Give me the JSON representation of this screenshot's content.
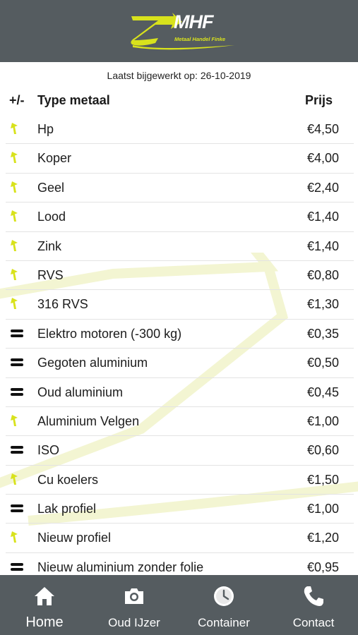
{
  "header": {
    "logo_letters": "MHF",
    "logo_subtitle": "Metaal Handel Finke",
    "background": "#555c60",
    "accent": "#d8e21c"
  },
  "updated_text": "Laatst bijgewerkt op: 26-10-2019",
  "table": {
    "headers": {
      "change": "+/-",
      "type": "Type metaal",
      "price": "Prijs"
    },
    "rows": [
      {
        "trend": "up",
        "name": "Hp",
        "price": "€4,50"
      },
      {
        "trend": "up",
        "name": "Koper",
        "price": "€4,00"
      },
      {
        "trend": "up",
        "name": "Geel",
        "price": "€2,40"
      },
      {
        "trend": "up",
        "name": "Lood",
        "price": "€1,40"
      },
      {
        "trend": "up",
        "name": "Zink",
        "price": "€1,40"
      },
      {
        "trend": "up",
        "name": "RVS",
        "price": "€0,80"
      },
      {
        "trend": "up",
        "name": "316 RVS",
        "price": "€1,30"
      },
      {
        "trend": "equal",
        "name": "Elektro motoren (-300 kg)",
        "price": "€0,35"
      },
      {
        "trend": "equal",
        "name": "Gegoten aluminium",
        "price": "€0,50"
      },
      {
        "trend": "equal",
        "name": "Oud aluminium",
        "price": "€0,45"
      },
      {
        "trend": "up",
        "name": "Aluminium Velgen",
        "price": "€1,00"
      },
      {
        "trend": "equal",
        "name": "ISO",
        "price": "€0,60"
      },
      {
        "trend": "up",
        "name": "Cu koelers",
        "price": "€1,50"
      },
      {
        "trend": "equal",
        "name": "Lak profiel",
        "price": "€1,00"
      },
      {
        "trend": "up",
        "name": "Nieuw profiel",
        "price": "€1,20"
      },
      {
        "trend": "equal",
        "name": "Nieuw aluminium zonder folie",
        "price": "€0,95"
      }
    ]
  },
  "tabs": [
    {
      "label": "Home",
      "icon": "home-icon",
      "active": true
    },
    {
      "label": "Oud IJzer",
      "icon": "camera-icon",
      "active": false
    },
    {
      "label": "Container",
      "icon": "clock-icon",
      "active": false
    },
    {
      "label": "Contact",
      "icon": "phone-icon",
      "active": false
    }
  ]
}
